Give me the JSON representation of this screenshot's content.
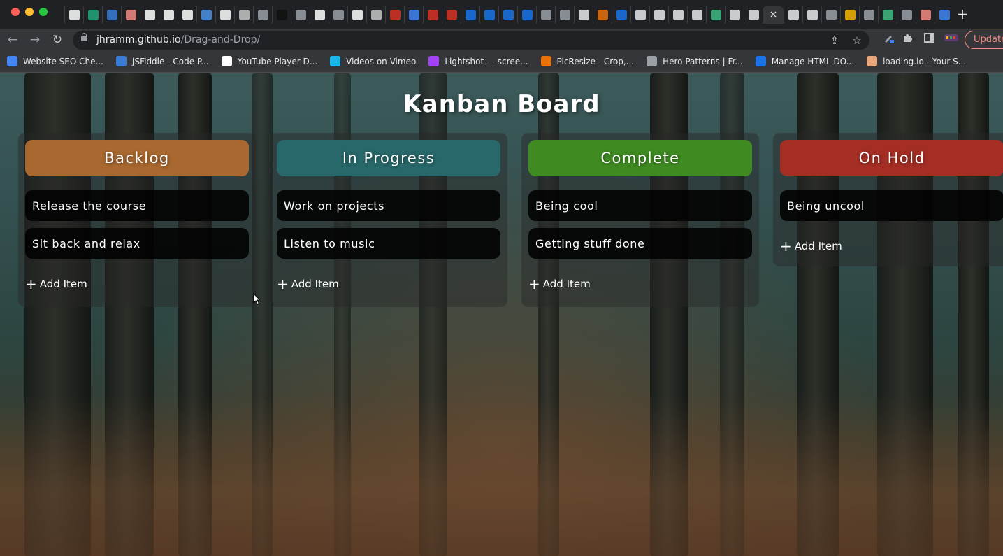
{
  "browser": {
    "tabs": {
      "favicons": [
        {
          "icon": "google-icon",
          "color": "#ffffff"
        },
        {
          "icon": "d-icon",
          "color": "#21a67a"
        },
        {
          "icon": "crescent-icon",
          "color": "#3a7bd5"
        },
        {
          "icon": "code-icon",
          "color": "#f28b82"
        },
        {
          "icon": "wikipedia-icon",
          "color": "#ffffff"
        },
        {
          "icon": "is-icon",
          "color": "#ffffff"
        },
        {
          "icon": "google-icon",
          "color": "#ffffff"
        },
        {
          "icon": "colorful-icon",
          "color": "#4a90e2"
        },
        {
          "icon": "google-icon",
          "color": "#ffffff"
        },
        {
          "icon": "chrome-icon",
          "color": "#c4c7c5"
        },
        {
          "icon": "globe-icon",
          "color": "#9aa0a6"
        },
        {
          "icon": "dark-icon",
          "color": "#111111"
        },
        {
          "icon": "globe-icon",
          "color": "#9aa0a6"
        },
        {
          "icon": "google-icon",
          "color": "#ffffff"
        },
        {
          "icon": "globe-icon",
          "color": "#9aa0a6"
        },
        {
          "icon": "codesandbox-icon",
          "color": "#ffffff"
        },
        {
          "icon": "chrome-icon",
          "color": "#c4c7c5"
        },
        {
          "icon": "red-shield-icon",
          "color": "#d93025"
        },
        {
          "icon": "triangle-icon",
          "color": "#4285f4"
        },
        {
          "icon": "red-x-icon",
          "color": "#d93025"
        },
        {
          "icon": "red-x-icon",
          "color": "#d93025"
        },
        {
          "icon": "doc-icon",
          "color": "#1a73e8"
        },
        {
          "icon": "doc-icon",
          "color": "#1a73e8"
        },
        {
          "icon": "doc-icon",
          "color": "#1a73e8"
        },
        {
          "icon": "doc-icon",
          "color": "#1a73e8"
        },
        {
          "icon": "globe-icon",
          "color": "#9aa0a6"
        },
        {
          "icon": "globe-icon",
          "color": "#9aa0a6"
        },
        {
          "icon": "m-icon",
          "color": "#e8eaed"
        },
        {
          "icon": "w3-icon",
          "color": "#e8710a"
        },
        {
          "icon": "w3-icon",
          "color": "#1a73e8"
        },
        {
          "icon": "m-icon",
          "color": "#e8eaed"
        },
        {
          "icon": "github-icon",
          "color": "#e8eaed"
        },
        {
          "icon": "github-icon",
          "color": "#e8eaed"
        },
        {
          "icon": "github-icon",
          "color": "#e8eaed"
        },
        {
          "icon": "vue-icon",
          "color": "#41b883"
        },
        {
          "icon": "github-icon",
          "color": "#e8eaed"
        },
        {
          "icon": "github-icon",
          "color": "#e8eaed"
        }
      ],
      "active_tab_close": "×",
      "favicons_after": [
        {
          "icon": "github-icon",
          "color": "#e8eaed"
        },
        {
          "icon": "github-icon",
          "color": "#e8eaed"
        },
        {
          "icon": "globe-icon",
          "color": "#9aa0a6"
        },
        {
          "icon": "image-icon",
          "color": "#f4b400"
        },
        {
          "icon": "folder-icon",
          "color": "#9aa0a6"
        },
        {
          "icon": "vue-icon",
          "color": "#41b883"
        },
        {
          "icon": "folder-icon",
          "color": "#9aa0a6"
        },
        {
          "icon": "code-icon",
          "color": "#f28b82"
        },
        {
          "icon": "flag-icon",
          "color": "#4285f4"
        }
      ],
      "new_tab": "+"
    },
    "toolbar": {
      "back": "←",
      "forward": "→",
      "reload": "↻",
      "url_host": "jhramm.github.io",
      "url_path": "/Drag-and-Drop/",
      "share": "⇪",
      "star": "☆",
      "update_label": "Update"
    },
    "bookmarks": [
      {
        "label": "Website SEO Che...",
        "icon": "link-icon",
        "color": "#4285f4"
      },
      {
        "label": "JSFiddle - Code P...",
        "icon": "cloud-icon",
        "color": "#3a7bd5"
      },
      {
        "label": "YouTube Player D...",
        "icon": "colorful-icon",
        "color": "#ffffff"
      },
      {
        "label": "Videos on Vimeo",
        "icon": "vimeo-icon",
        "color": "#1ab7ea"
      },
      {
        "label": "Lightshot — scree...",
        "icon": "feather-icon",
        "color": "#a142f4"
      },
      {
        "label": "PicResize - Crop,...",
        "icon": "grid-icon",
        "color": "#e8710a"
      },
      {
        "label": "Hero Patterns | Fr...",
        "icon": "globe-icon",
        "color": "#9aa0a6"
      },
      {
        "label": "Manage HTML DO...",
        "icon": "d-icon",
        "color": "#1a73e8"
      },
      {
        "label": "loading.io - Your S...",
        "icon": "loading-icon",
        "color": "#e8a87c"
      }
    ]
  },
  "board": {
    "title": "Kanban Board",
    "columns": [
      {
        "title": "Backlog",
        "color": "#a8682f",
        "items": [
          "Release the course",
          "Sit back and relax"
        ],
        "add_label": "Add Item"
      },
      {
        "title": "In Progress",
        "color": "#28686a",
        "items": [
          "Work on projects",
          "Listen to music"
        ],
        "add_label": "Add Item"
      },
      {
        "title": "Complete",
        "color": "#3f8b22",
        "items": [
          "Being cool",
          "Getting stuff done"
        ],
        "add_label": "Add Item"
      },
      {
        "title": "On Hold",
        "color": "#a42e24",
        "items": [
          "Being uncool"
        ],
        "add_label": "Add Item"
      }
    ],
    "add_icon": "+"
  }
}
